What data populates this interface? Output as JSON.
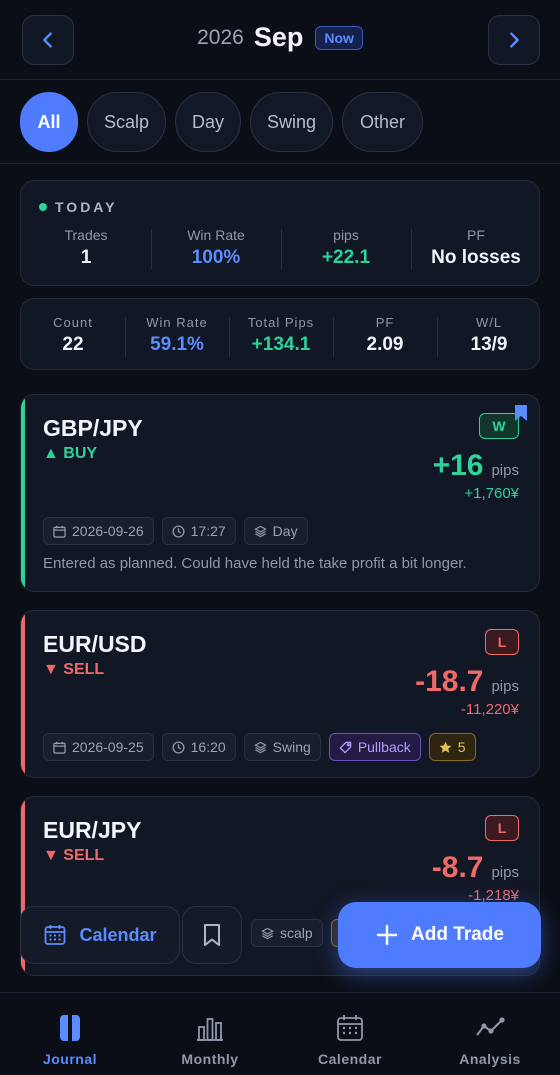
{
  "header": {
    "year": "2026",
    "month": "Sep",
    "now_badge": "Now",
    "prev_icon": "chevron-left-icon",
    "next_icon": "chevron-right-icon"
  },
  "filters": [
    {
      "label": "All",
      "active": true
    },
    {
      "label": "Scalp",
      "active": false
    },
    {
      "label": "Day",
      "active": false
    },
    {
      "label": "Swing",
      "active": false
    },
    {
      "label": "Other",
      "active": false
    }
  ],
  "today": {
    "label": "TODAY",
    "stats": [
      {
        "label": "Trades",
        "value": "1"
      },
      {
        "label": "Win Rate",
        "value": "100%"
      },
      {
        "label": "pips",
        "value": "+22.1"
      },
      {
        "label": "PF",
        "value": "No losses"
      }
    ]
  },
  "summary": {
    "stats": [
      {
        "label": "Count",
        "value": "22"
      },
      {
        "label": "Win Rate",
        "value": "59.1%"
      },
      {
        "label": "Total Pips",
        "value": "+134.1"
      },
      {
        "label": "PF",
        "value": "2.09"
      },
      {
        "label": "W/L",
        "value": "13/9"
      }
    ]
  },
  "trades": [
    {
      "pair": "GBP/JPY",
      "side": "▲ BUY",
      "result": "W",
      "bookmarked": true,
      "pips": "+16",
      "pips_unit": "pips",
      "money": "+1,760¥",
      "date": "2026-09-26",
      "time": "17:27",
      "style": "Day",
      "note": "Entered as planned. Could have held the take profit a bit longer."
    },
    {
      "pair": "EUR/USD",
      "side": "▼ SELL",
      "result": "L",
      "pips": "-18.7",
      "pips_unit": "pips",
      "money": "-11,220¥",
      "date": "2026-09-25",
      "time": "16:20",
      "style": "Swing",
      "setup": "Pullback",
      "rating": "5"
    },
    {
      "pair": "EUR/JPY",
      "side": "▼ SELL",
      "result": "L",
      "pips": "-8.7",
      "pips_unit": "pips",
      "money": "-1,218¥",
      "style": "scalp"
    }
  ],
  "actions": {
    "calendar_label": "Calendar",
    "add_trade_label": "Add Trade"
  },
  "tabs": [
    {
      "label": "Journal",
      "icon": "journal-icon",
      "active": true
    },
    {
      "label": "Monthly",
      "icon": "bar-chart-icon",
      "active": false
    },
    {
      "label": "Calendar",
      "icon": "calendar-icon",
      "active": false
    },
    {
      "label": "Analysis",
      "icon": "line-chart-icon",
      "active": false
    }
  ],
  "colors": {
    "accent": "#4f7cff",
    "win": "#2fd39a",
    "loss": "#f06a6a",
    "background": "#0b0e16"
  }
}
